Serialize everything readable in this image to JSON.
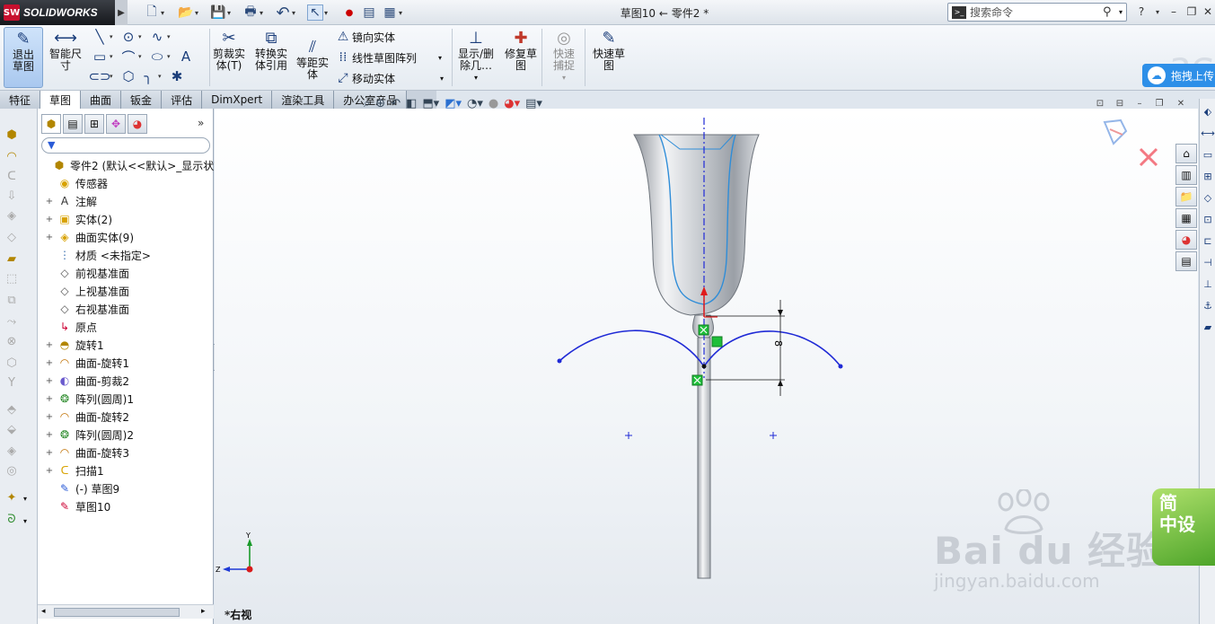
{
  "app": {
    "logo_text": "SOLIDWORKS",
    "logo_badge": "SW",
    "doc_title": "草图10 ← 零件2 *"
  },
  "search": {
    "placeholder": "搜索命令"
  },
  "commands": {
    "exit_sketch": "退出草图",
    "smart_dim": "智能尺寸",
    "trim": "剪裁实体(T)",
    "convert": "转换实体引用",
    "offset": "等距实体",
    "mirror": "镜向实体",
    "linear_pattern": "线性草图阵列",
    "move": "移动实体",
    "display_delete": "显示/删除几…",
    "repair": "修复草图",
    "quick_snap": "快速捕捉",
    "rapid_sketch": "快速草图"
  },
  "drag_tip": "拖拽上传",
  "tabs": [
    "特征",
    "草图",
    "曲面",
    "钣金",
    "评估",
    "DimXpert",
    "渲染工具",
    "办公室产品"
  ],
  "active_tab": "草图",
  "tree": [
    {
      "label": "零件2  (默认<<默认>_显示状态",
      "icon": "part-icon",
      "expand": ""
    },
    {
      "label": "传感器",
      "icon": "sensor-icon",
      "expand": ""
    },
    {
      "label": "注解",
      "icon": "annotation-icon",
      "expand": "+"
    },
    {
      "label": "实体(2)",
      "icon": "solid-body-icon",
      "expand": "+"
    },
    {
      "label": "曲面实体(9)",
      "icon": "surface-body-icon",
      "expand": "+"
    },
    {
      "label": "材质 <未指定>",
      "icon": "material-icon",
      "expand": ""
    },
    {
      "label": "前视基准面",
      "icon": "plane-icon",
      "expand": ""
    },
    {
      "label": "上视基准面",
      "icon": "plane-icon",
      "expand": ""
    },
    {
      "label": "右视基准面",
      "icon": "plane-icon",
      "expand": ""
    },
    {
      "label": "原点",
      "icon": "origin-icon",
      "expand": ""
    },
    {
      "label": "旋转1",
      "icon": "revolve-icon",
      "expand": "+"
    },
    {
      "label": "曲面-旋转1",
      "icon": "surface-revolve-icon",
      "expand": "+"
    },
    {
      "label": "曲面-剪裁2",
      "icon": "surface-trim-icon",
      "expand": "+"
    },
    {
      "label": "阵列(圆周)1",
      "icon": "circular-pattern-icon",
      "expand": "+"
    },
    {
      "label": "曲面-旋转2",
      "icon": "surface-revolve-icon",
      "expand": "+"
    },
    {
      "label": "阵列(圆周)2",
      "icon": "circular-pattern-icon",
      "expand": "+"
    },
    {
      "label": "曲面-旋转3",
      "icon": "surface-revolve-icon",
      "expand": "+"
    },
    {
      "label": "扫描1",
      "icon": "sweep-icon",
      "expand": "+"
    },
    {
      "label": "(-) 草图9",
      "icon": "sketch-icon",
      "expand": ""
    },
    {
      "label": "草图10",
      "icon": "sketch-active-icon",
      "expand": ""
    }
  ],
  "viewport": {
    "view_name": "*右视",
    "dimension": "8",
    "triad_y": "Y",
    "triad_z": "Z"
  },
  "watermark": {
    "brand": "Bai du 经验",
    "url": "jingyan.baidu.com",
    "badge_line1": "简",
    "badge_line2": "中设"
  },
  "colors": {
    "sketch_blue": "#1f2ad6",
    "relation_green": "#1fbf3a",
    "accent_blue": "#2d8fe8"
  }
}
